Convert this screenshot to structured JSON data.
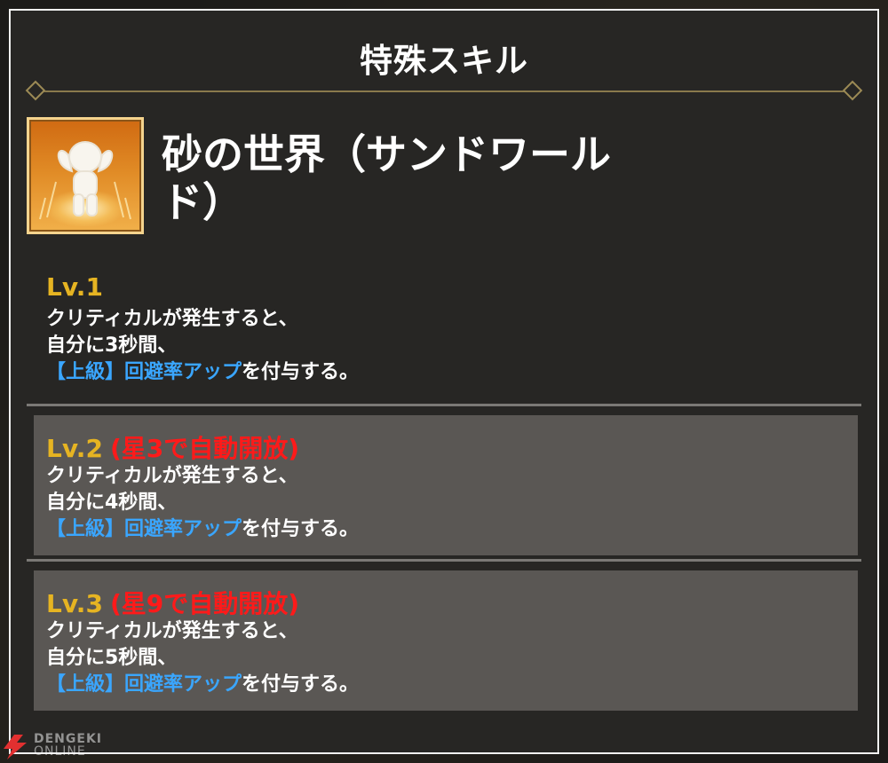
{
  "panel": {
    "title": "特殊スキル"
  },
  "skill": {
    "icon": "flexing-figure-icon",
    "name_line1": "砂の世界（サンドワール",
    "name_line2": "ド）"
  },
  "levels": [
    {
      "label": "Lv.1",
      "unlock": "",
      "line1": "クリティカルが発生すると、",
      "line2": "自分に3秒間、",
      "highlight": "【上級】回避率アップ",
      "suffix": "を付与する。"
    },
    {
      "label": "Lv.2",
      "unlock": "(星3で自動開放)",
      "line1": "クリティカルが発生すると、",
      "line2": "自分に4秒間、",
      "highlight": "【上級】回避率アップ",
      "suffix": "を付与する。"
    },
    {
      "label": "Lv.3",
      "unlock": "(星9で自動開放)",
      "line1": "クリティカルが発生すると、",
      "line2": "自分に5秒間、",
      "highlight": "【上級】回避率アップ",
      "suffix": "を付与する。"
    }
  ],
  "watermark": {
    "line1": "DENGEKI",
    "line2": "ONLINE",
    "icon": "lightning-bolt-icon"
  },
  "colors": {
    "level_label": "#e6b422",
    "unlock_text": "#ff1a1a",
    "highlight_text": "#3aa6ff",
    "panel_bg": "#272624",
    "locked_level_bg": "#5a5754",
    "divider_gold": "#8a7a4c"
  }
}
